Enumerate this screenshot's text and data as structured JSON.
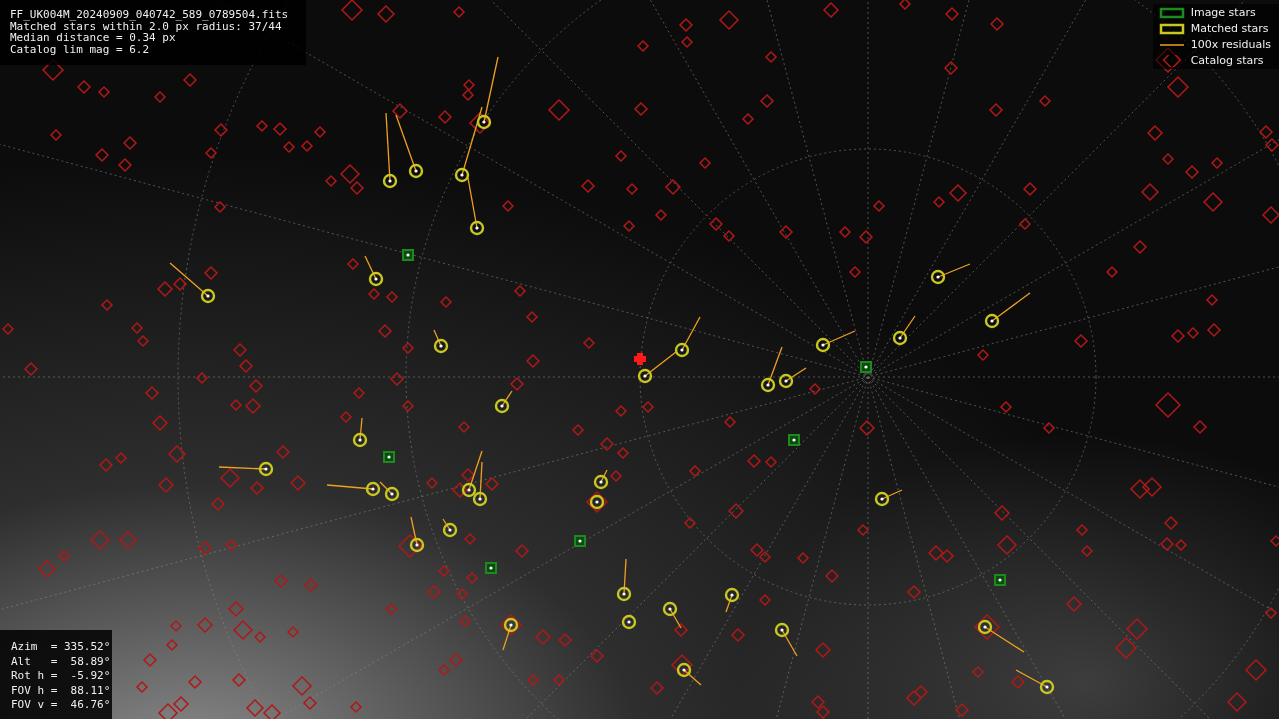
{
  "info_box": {
    "lines": [
      "FF_UK004M_20240909_040742_589_0789504.fits",
      "Matched stars within 2.0 px radius: 37/44",
      "Median distance = 0.34 px",
      "Catalog lim mag = 6.2"
    ]
  },
  "legend": {
    "items": [
      {
        "kind": "image",
        "label": "Image stars"
      },
      {
        "kind": "matched",
        "label": "Matched stars"
      },
      {
        "kind": "residual",
        "label": "100x residuals"
      },
      {
        "kind": "catalog",
        "label": "Catalog stars"
      }
    ]
  },
  "pointing_box": {
    "lines": [
      "Azim  = 335.52°",
      "Alt   =  58.89°",
      "Rot h =  -5.92°",
      "FOV h =  88.11°",
      "FOV v =  46.76°"
    ]
  }
}
